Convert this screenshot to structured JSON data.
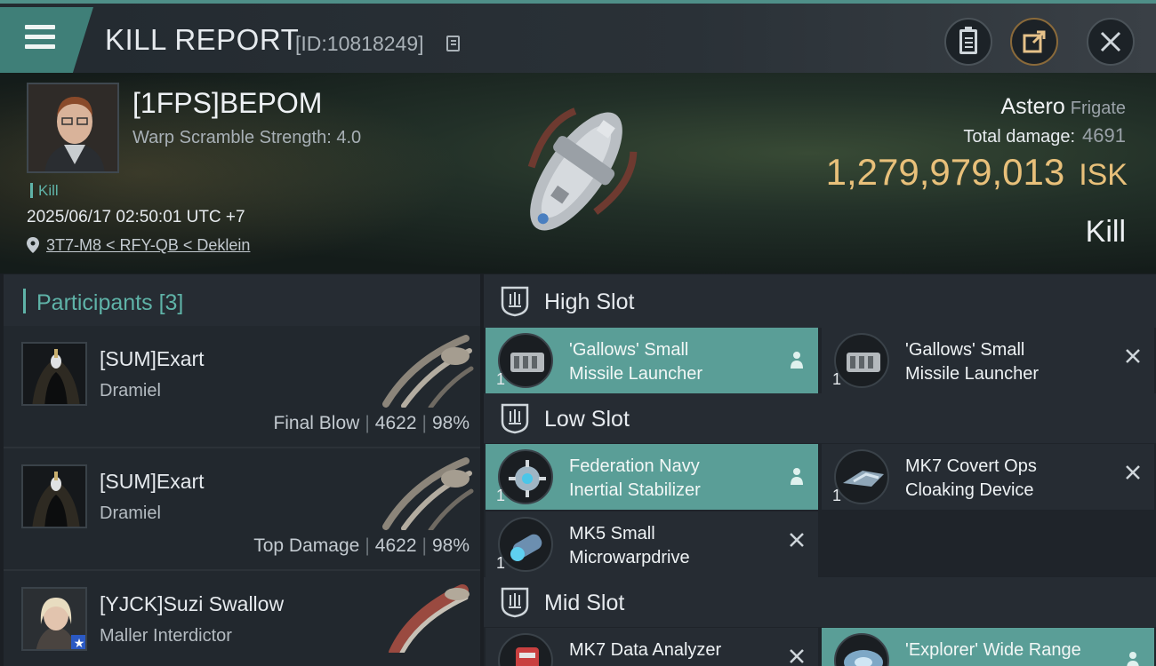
{
  "header": {
    "title": "KILL REPORT",
    "kill_id": "[ID:10818249]",
    "icons": [
      "menu-icon",
      "copy-icon",
      "clipboard-icon",
      "share-icon",
      "close-icon"
    ]
  },
  "victim": {
    "pilot": "[1FPS]BEPOM",
    "scramble": "Warp Scramble Strength: 4.0",
    "tag": "Kill",
    "datetime": "2025/06/17 02:50:01 UTC +7",
    "location": "3T7-M8 < RFY-QB < Deklein",
    "ship_name": "Astero",
    "ship_class": "Frigate",
    "total_damage_label": "Total damage:",
    "total_damage": "4691",
    "isk_value": "1,279,979,013",
    "isk_unit": "ISK",
    "result": "Kill"
  },
  "participants": {
    "title": "Participants",
    "count": "[3]",
    "rows": [
      {
        "name": "[SUM]Exart",
        "ship": "Dramiel",
        "role": "Final Blow",
        "damage": "4622",
        "percent": "98%"
      },
      {
        "name": "[SUM]Exart",
        "ship": "Dramiel",
        "role": "Top Damage",
        "damage": "4622",
        "percent": "98%"
      },
      {
        "name": "[YJCK]Suzi Swallow",
        "ship": "Maller Interdictor",
        "role": "",
        "damage": "",
        "percent": ""
      }
    ]
  },
  "slots": {
    "high": {
      "label": "High Slot",
      "items": [
        {
          "line1": "'Gallows' Small",
          "line2": "Missile Launcher",
          "qty": "1",
          "status": "dropped"
        },
        {
          "line1": "'Gallows' Small",
          "line2": "Missile Launcher",
          "qty": "1",
          "status": "destroyed"
        }
      ]
    },
    "low": {
      "label": "Low Slot",
      "items": [
        {
          "line1": "Federation Navy",
          "line2": "Inertial Stabilizer",
          "qty": "1",
          "status": "dropped"
        },
        {
          "line1": "MK7 Covert Ops",
          "line2": "Cloaking Device",
          "qty": "1",
          "status": "destroyed"
        },
        {
          "line1": "MK5 Small",
          "line2": "Microwarpdrive",
          "qty": "1",
          "status": "destroyed"
        }
      ]
    },
    "mid": {
      "label": "Mid Slot",
      "items": [
        {
          "line1": "MK7 Data Analyzer",
          "line2": "",
          "qty": "",
          "status": "destroyed"
        },
        {
          "line1": "'Explorer' Wide Range",
          "line2": "",
          "qty": "",
          "status": "dropped"
        }
      ]
    }
  },
  "colors": {
    "accent_teal": "#5a9e97",
    "isk_gold": "#e8c07a",
    "panel": "#262c33"
  }
}
